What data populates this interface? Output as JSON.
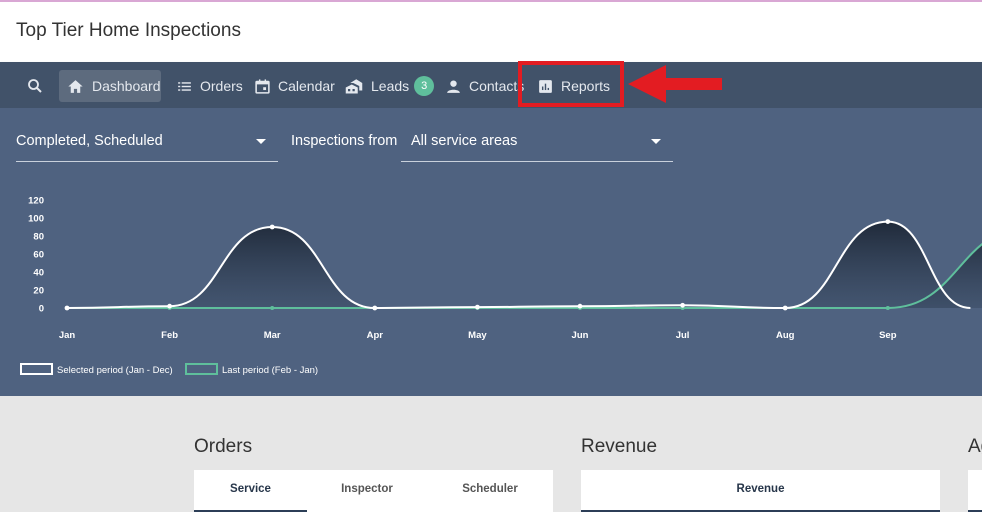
{
  "app": {
    "title": "Top Tier Home Inspections"
  },
  "nav": {
    "items": [
      {
        "key": "search",
        "icon": "search-icon",
        "label": ""
      },
      {
        "key": "dashboard",
        "icon": "home-icon",
        "label": "Dashboard",
        "active": true
      },
      {
        "key": "orders",
        "icon": "list-icon",
        "label": "Orders"
      },
      {
        "key": "calendar",
        "icon": "calendar-icon",
        "label": "Calendar"
      },
      {
        "key": "leads",
        "icon": "leads-icon",
        "label": "Leads",
        "badge": "3"
      },
      {
        "key": "contacts",
        "icon": "person-icon",
        "label": "Contacts"
      },
      {
        "key": "reports",
        "icon": "bar-chart-icon",
        "label": "Reports"
      }
    ],
    "dashboard_label": "Dashboard",
    "orders_label": "Orders",
    "calendar_label": "Calendar",
    "leads_label": "Leads",
    "leads_badge": "3",
    "contacts_label": "Contacts",
    "reports_label": "Reports"
  },
  "annotation": {
    "highlight_color": "#e31c22",
    "target": "reports"
  },
  "filters": {
    "status_value": "Completed, Scheduled",
    "inspections_from_label": "Inspections from",
    "area_value": "All service areas"
  },
  "chart_data": {
    "type": "line",
    "categories": [
      "Jan",
      "Feb",
      "Mar",
      "Apr",
      "May",
      "Jun",
      "Jul",
      "Aug",
      "Sep"
    ],
    "yticks": [
      "120",
      "100",
      "80",
      "60",
      "40",
      "20",
      "0"
    ],
    "ylim": [
      0,
      120
    ],
    "grid": false,
    "legend_position": "bottom-left",
    "series": [
      {
        "name": "Selected period  (Jan - Dec)",
        "color": "#ffffff",
        "values": [
          0,
          2,
          90,
          0,
          1,
          2,
          3,
          0,
          96
        ]
      },
      {
        "name": "Last period  (Feb - Jan)",
        "color": "#5fbf9c",
        "values": [
          0,
          0,
          0,
          0,
          0,
          0,
          0,
          0,
          0
        ]
      }
    ]
  },
  "sections": {
    "orders_title": "Orders",
    "orders_tabs": [
      "Service",
      "Inspector",
      "Scheduler"
    ],
    "revenue_title": "Revenue",
    "revenue_tabs": [
      "Revenue"
    ],
    "agents_title": "Ag"
  }
}
